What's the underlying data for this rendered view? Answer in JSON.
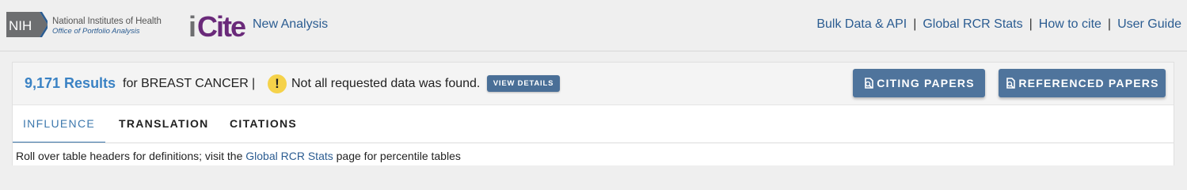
{
  "header": {
    "nih_logo_text": "NIH",
    "nih_name": "National Institutes of Health",
    "nih_office": "Office of Portfolio Analysis",
    "app_logo_text": "iCite",
    "new_analysis": "New Analysis",
    "nav": [
      {
        "label": "Bulk Data & API"
      },
      {
        "label": "Global RCR Stats"
      },
      {
        "label": "How to cite"
      },
      {
        "label": "User Guide"
      }
    ],
    "nav_separator": "|"
  },
  "results": {
    "count": "9,171 Results",
    "query_text": "for BREAST CANCER",
    "separator": "|",
    "warning_icon": "exclamation-icon",
    "warning_text": "Not all requested data was found.",
    "view_details_label": "VIEW DETAILS",
    "citing_papers_label": "CITING PAPERS",
    "referenced_papers_label": "REFERENCED PAPERS"
  },
  "tabs": [
    {
      "label": "INFLUENCE",
      "active": true
    },
    {
      "label": "TRANSLATION",
      "active": false
    },
    {
      "label": "CITATIONS",
      "active": false
    }
  ],
  "hint": {
    "before": "Roll over table headers for definitions; visit the ",
    "link": "Global RCR Stats",
    "after": " page for percentile tables"
  },
  "colors": {
    "accent": "#2b5c91",
    "results_blue": "#3a82c4",
    "button_blue": "#4f749c",
    "warning_yellow": "#f5d24a",
    "icite_purple": "#6a2a7a"
  }
}
